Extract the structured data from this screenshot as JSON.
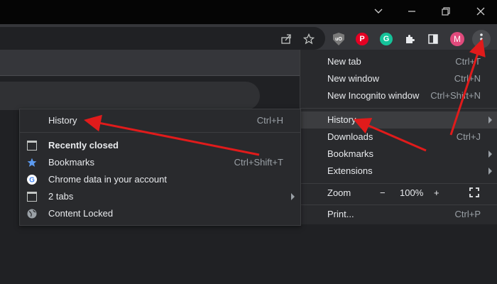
{
  "window_controls": {
    "collapse_icon": "chevron-down-icon",
    "minimize_icon": "minimize-icon",
    "restore_icon": "restore-icon",
    "close_icon": "close-icon"
  },
  "toolbar": {
    "icons": [
      "share-icon",
      "star-icon",
      "ublock-icon",
      "pinterest-icon",
      "grammarly-icon",
      "extensions-icon",
      "side-panel-icon",
      "profile-avatar",
      "menu-icon"
    ],
    "ublock_text": "uO",
    "pinterest_text": "P",
    "grammarly_text": "G",
    "profile_initial": "M",
    "profile_color": "#e04a7c",
    "pinterest_color": "#e60023",
    "grammarly_color": "#15c39a"
  },
  "main_menu": {
    "new_tab": {
      "label": "New tab",
      "shortcut": "Ctrl+T"
    },
    "new_window": {
      "label": "New window",
      "shortcut": "Ctrl+N"
    },
    "new_incognito": {
      "label": "New Incognito window",
      "shortcut": "Ctrl+Shift+N"
    },
    "history": {
      "label": "History"
    },
    "downloads": {
      "label": "Downloads",
      "shortcut": "Ctrl+J"
    },
    "bookmarks": {
      "label": "Bookmarks"
    },
    "extensions": {
      "label": "Extensions"
    },
    "zoom": {
      "label": "Zoom",
      "minus": "−",
      "value": "100%",
      "plus": "+"
    },
    "print": {
      "label": "Print...",
      "shortcut": "Ctrl+P"
    }
  },
  "history_submenu": {
    "history": {
      "label": "History",
      "shortcut": "Ctrl+H"
    },
    "recently_closed": {
      "label": "Recently closed"
    },
    "bookmarks": {
      "label": "Bookmarks",
      "shortcut": "Ctrl+Shift+T"
    },
    "chrome_data": {
      "label": "Chrome data in your account"
    },
    "tabs": {
      "label": "2 tabs"
    },
    "content_locked": {
      "label": "Content Locked"
    }
  },
  "annotation_color": "#e01b1b",
  "accent_blue": "#5c9bf0"
}
